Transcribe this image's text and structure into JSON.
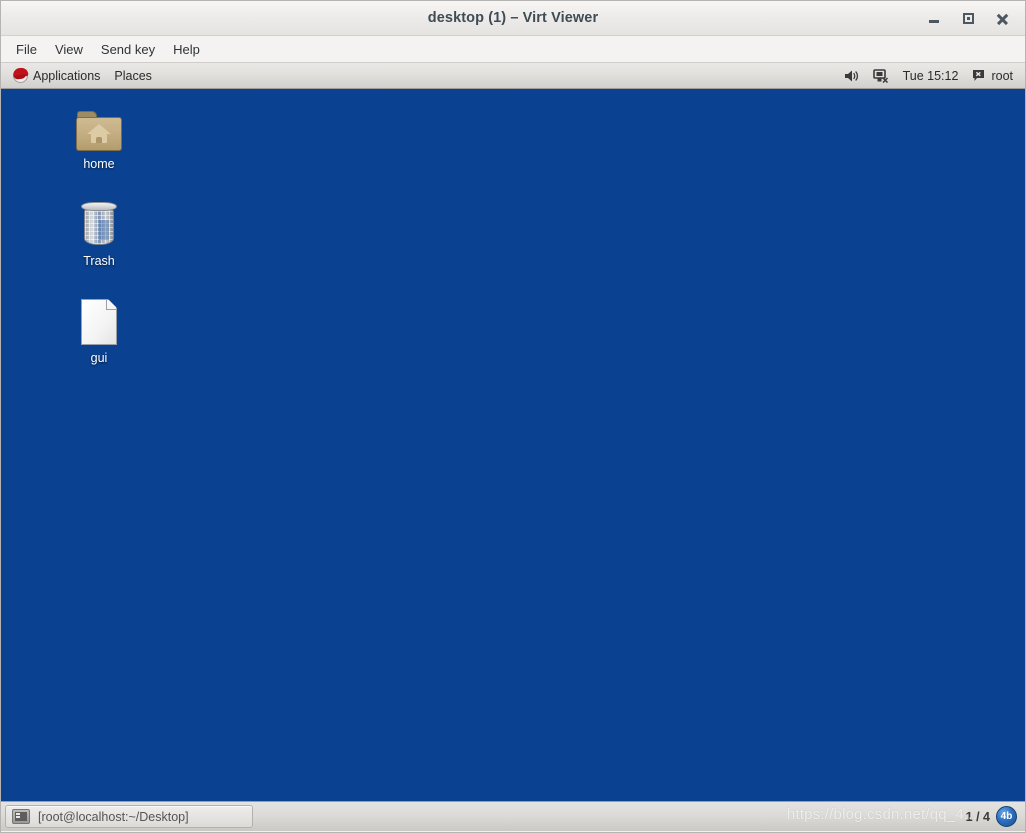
{
  "window": {
    "title": "desktop (1) – Virt Viewer",
    "controls": {
      "minimize_label": "Minimize",
      "maximize_label": "Maximize",
      "close_label": "Close"
    }
  },
  "menubar": {
    "items": [
      {
        "label": "File"
      },
      {
        "label": "View"
      },
      {
        "label": "Send key"
      },
      {
        "label": "Help"
      }
    ]
  },
  "guest_desktop": {
    "background_color": "#0a4291",
    "top_panel": {
      "menus": [
        {
          "label": "Applications",
          "icon": "fedora-logo-icon"
        },
        {
          "label": "Places",
          "icon": ""
        }
      ],
      "tray": {
        "volume_icon": "volume-icon",
        "network_icon": "network-disconnected-icon",
        "clock": "Tue 15:12",
        "user_icon": "messaging-icon",
        "user": "root"
      }
    },
    "icons": [
      {
        "label": "home",
        "type": "home-folder-icon"
      },
      {
        "label": "Trash",
        "type": "trash-icon"
      },
      {
        "label": "gui",
        "type": "document-icon"
      }
    ],
    "bottom_panel": {
      "tasks": [
        {
          "label": "[root@localhost:~/Desktop]",
          "icon": "terminal-icon"
        }
      ],
      "workspace_switcher": {
        "label": "1 / 4",
        "badge": "4b"
      }
    },
    "watermark": "https://blog.csdn.net/qq_4..."
  }
}
